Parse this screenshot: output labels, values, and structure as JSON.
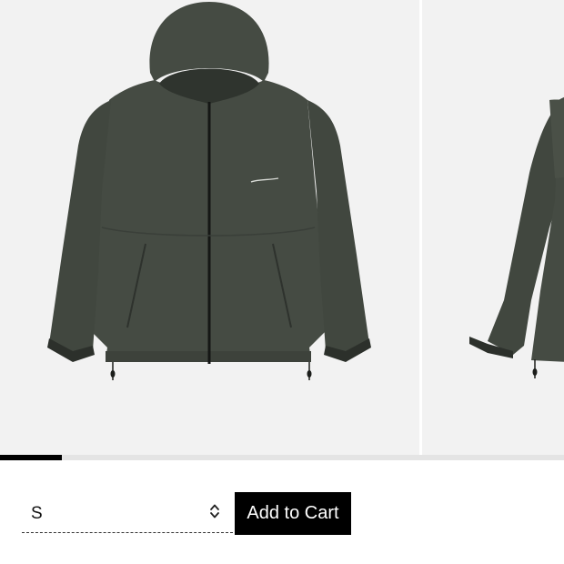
{
  "product": {
    "images": [
      {
        "icon": "jacket-front-image"
      },
      {
        "icon": "jacket-side-image"
      }
    ],
    "gallery_progress": 0.11
  },
  "purchase": {
    "size_selected": "S",
    "size_options": [
      "S"
    ],
    "add_to_cart_label": "Add to Cart"
  },
  "colors": {
    "gallery_bg": "#f2f2f2",
    "jacket": "#454b43",
    "button_bg": "#000000",
    "progress_fill": "#000000",
    "progress_track": "#e4e4e4"
  }
}
